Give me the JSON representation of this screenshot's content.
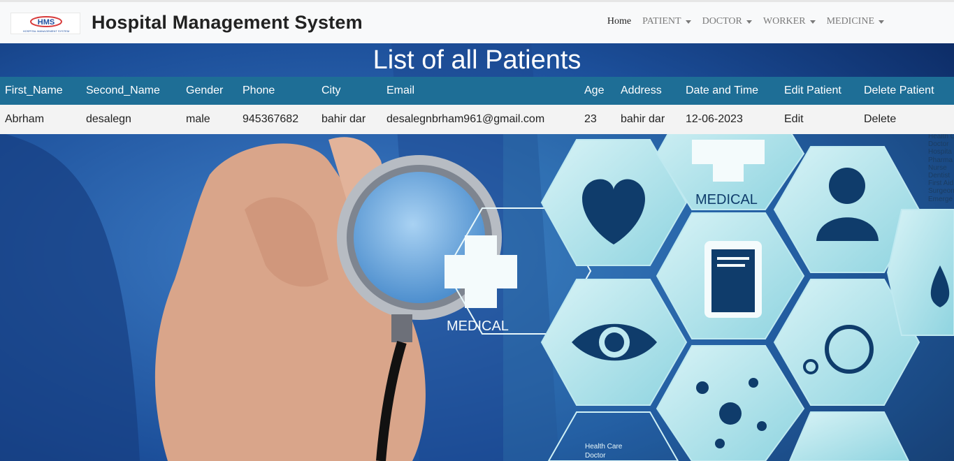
{
  "app": {
    "logo_text": "HMS",
    "logo_subtext": "HOSPITAL MANAGEMENT SYSTEM",
    "brand": "Hospital Management System"
  },
  "nav": {
    "home": "Home",
    "patient": "PATIENT",
    "doctor": "DOCTOR",
    "worker": "WORKER",
    "medicine": "MEDICINE"
  },
  "page": {
    "title": "List of all Patients"
  },
  "table": {
    "headers": [
      "First_Name",
      "Second_Name",
      "Gender",
      "Phone",
      "City",
      "Email",
      "Age",
      "Address",
      "Date and Time",
      "Edit Patient",
      "Delete Patient"
    ],
    "rows": [
      {
        "first_name": "Abrham",
        "second_name": "desalegn",
        "gender": "male",
        "phone": "945367682",
        "city": "bahir dar",
        "email": "desalegnbrham961@gmail.com",
        "age": "23",
        "address": "bahir dar",
        "date_time": "12-06-2023",
        "edit": "Edit",
        "delete": "Delete"
      }
    ]
  },
  "background": {
    "hex_labels": [
      "MEDICAL",
      "MEDICAL"
    ],
    "side_list": [
      "Health C",
      "Doctor",
      "Hospita",
      "Pharma",
      "Nurse",
      "Dentist",
      "First Aid",
      "Surgeon",
      "Emerge"
    ],
    "bottom_list": [
      "Health Care",
      "Doctor"
    ]
  },
  "colors": {
    "header_bg": "#1e6e96",
    "navbar_bg": "#f8f9fa"
  }
}
